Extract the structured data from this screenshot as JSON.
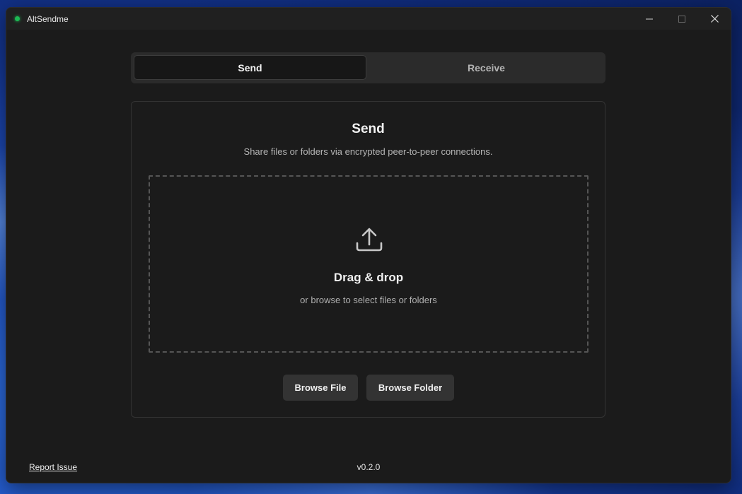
{
  "window": {
    "title": "AltSendme"
  },
  "tabs": [
    {
      "label": "Send",
      "active": true
    },
    {
      "label": "Receive",
      "active": false
    }
  ],
  "card": {
    "title": "Send",
    "subtitle": "Share files or folders via encrypted peer-to-peer connections."
  },
  "dropzone": {
    "icon": "upload-icon",
    "title": "Drag & drop",
    "hint": "or browse to select files or folders"
  },
  "actions": {
    "browse_file": "Browse File",
    "browse_folder": "Browse Folder"
  },
  "footer": {
    "report_issue": "Report Issue",
    "version": "v0.2.0"
  },
  "colors": {
    "status_dot": "#1db954",
    "window_bg": "#1b1b1b",
    "button_bg": "#333333"
  }
}
